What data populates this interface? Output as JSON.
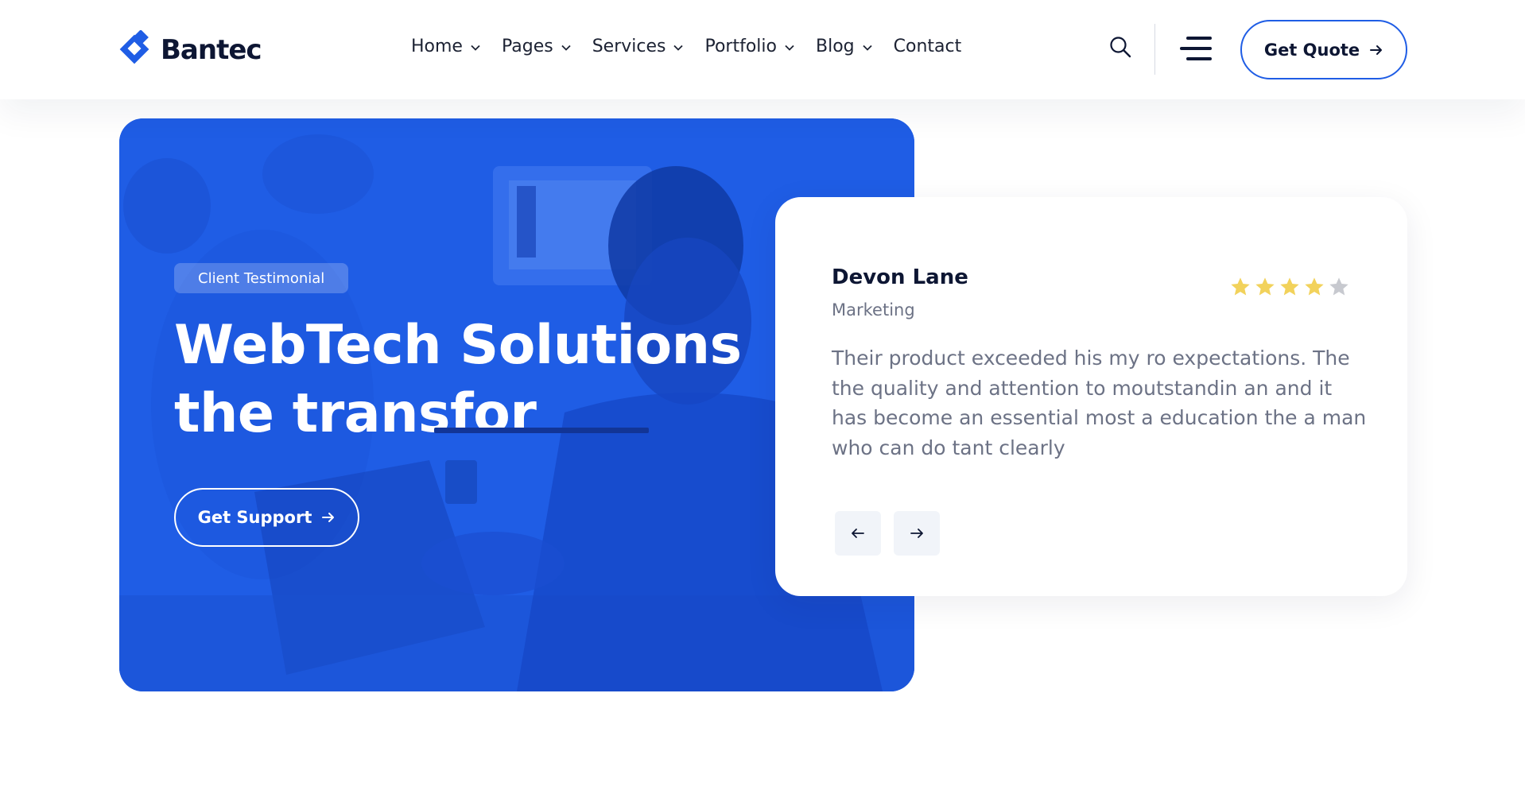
{
  "brand": {
    "name": "Bantec",
    "accent_color": "#1f5de5",
    "dark_color": "#0d1633"
  },
  "nav": {
    "items": [
      {
        "label": "Home",
        "dropdown": true
      },
      {
        "label": "Pages",
        "dropdown": true
      },
      {
        "label": "Services",
        "dropdown": true
      },
      {
        "label": "Portfolio",
        "dropdown": true
      },
      {
        "label": "Blog",
        "dropdown": true
      },
      {
        "label": "Contact",
        "dropdown": false
      }
    ]
  },
  "header_actions": {
    "search_icon": "search-icon",
    "menu_icon": "hamburger-menu-icon",
    "quote_label": "Get Quote",
    "quote_icon": "arrow-right-icon"
  },
  "hero": {
    "badge": "Client Testimonial",
    "title": "WebTech Solutions the transfor",
    "support_label": "Get Support",
    "support_icon": "arrow-right-icon"
  },
  "testimonial": {
    "name": "Devon Lane",
    "role": "Marketing",
    "rating": 4,
    "rating_max": 5,
    "star_color": "#f2d25b",
    "empty_star_color": "#c7c9cf",
    "quote": "Their product exceeded his my ro expectations. The the quality and attention to moutstandin an and it has become an essential most a education the a man who can do tant clearly",
    "prev_icon": "arrow-left-icon",
    "next_icon": "arrow-right-icon"
  }
}
